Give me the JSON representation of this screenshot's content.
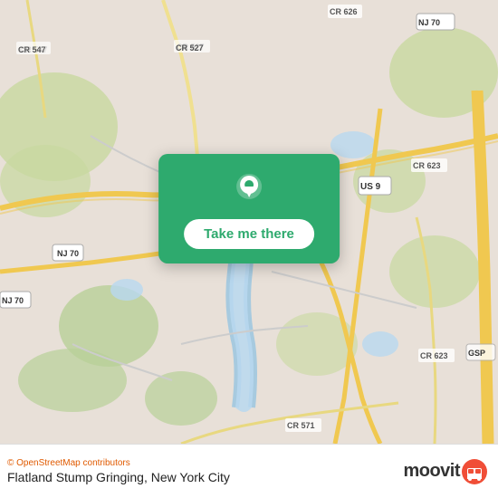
{
  "map": {
    "alt": "Map of New Jersey area near Flatland Stump Gringing",
    "background_color": "#e8e0d8"
  },
  "card": {
    "button_label": "Take me there",
    "pin_icon": "location-pin"
  },
  "bottom_bar": {
    "osm_credit": "© OpenStreetMap contributors",
    "location_name": "Flatland Stump Gringing, New York City",
    "moovit_label": "moovit"
  }
}
